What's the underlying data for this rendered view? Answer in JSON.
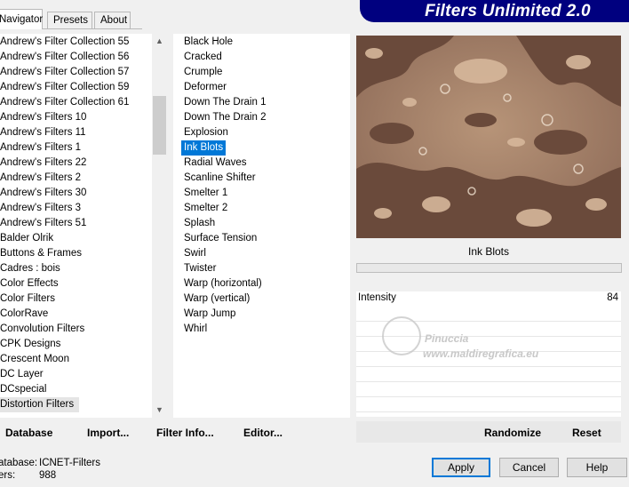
{
  "tabs": [
    "Navigator",
    "Presets",
    "About"
  ],
  "banner_title": "Filters Unlimited 2.0",
  "categories": [
    "Andrew's Filter Collection 55",
    "Andrew's Filter Collection 56",
    "Andrew's Filter Collection 57",
    "Andrew's Filter Collection 59",
    "Andrew's Filter Collection 61",
    "Andrew's Filters 10",
    "Andrew's Filters 11",
    "Andrew's Filters 1",
    "Andrew's Filters 22",
    "Andrew's Filters 2",
    "Andrew's Filters 30",
    "Andrew's Filters 3",
    "Andrew's Filters 51",
    "Balder Olrik",
    "Buttons & Frames",
    "Cadres : bois",
    "Color Effects",
    "Color Filters",
    "ColorRave",
    "Convolution Filters",
    "CPK Designs",
    "Crescent Moon",
    "DC Layer",
    "DCspecial",
    "Distortion Filters"
  ],
  "selected_category": "Distortion Filters",
  "filters": [
    "Black Hole",
    "Cracked",
    "Crumple",
    "Deformer",
    "Down The Drain 1",
    "Down The Drain 2",
    "Explosion",
    "Ink Blots",
    "Radial Waves",
    "Scanline Shifter",
    "Smelter 1",
    "Smelter 2",
    "Splash",
    "Surface Tension",
    "Swirl",
    "Twister",
    "Warp (horizontal)",
    "Warp (vertical)",
    "Warp Jump",
    "Whirl"
  ],
  "selected_filter": "Ink Blots",
  "preview_title": "Ink Blots",
  "param": {
    "label": "Intensity",
    "value": "84"
  },
  "watermark": {
    "line1": "Pinuccia",
    "line2": "www.maldiregrafica.eu"
  },
  "bottom_left": {
    "database": "Database",
    "import": "Import...",
    "filter_info": "Filter Info...",
    "editor": "Editor..."
  },
  "bottom_right": {
    "randomize": "Randomize",
    "reset": "Reset"
  },
  "status": {
    "db_label": "atabase:",
    "db_value": "ICNET-Filters",
    "filters_label": "ers:",
    "filters_value": "988"
  },
  "buttons": {
    "apply": "Apply",
    "cancel": "Cancel",
    "help": "Help"
  },
  "colors": {
    "banner": "#00007f",
    "selection": "#0078d7",
    "preview_dark": "#6b4a3c",
    "preview_light": "#c9a78b"
  }
}
